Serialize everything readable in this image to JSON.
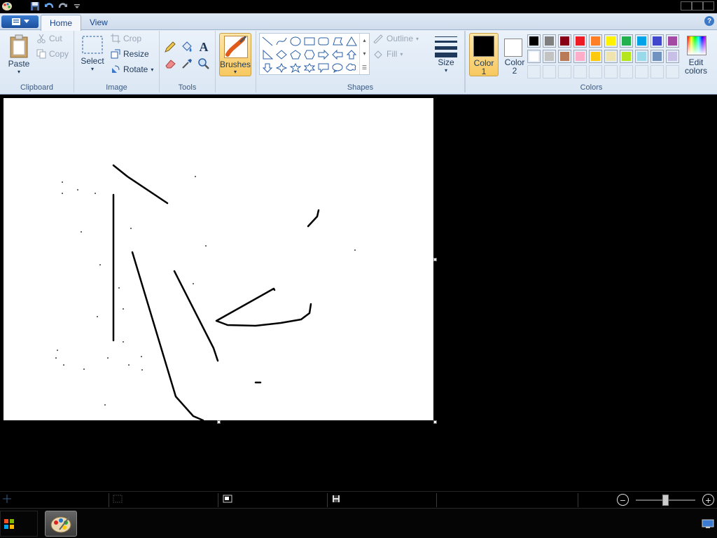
{
  "ribbon": {
    "tabs": [
      {
        "label": "Home",
        "active": true
      },
      {
        "label": "View",
        "active": false
      }
    ],
    "help_label": "?",
    "groups": {
      "clipboard": {
        "label": "Clipboard",
        "paste": "Paste",
        "cut": "Cut",
        "copy": "Copy"
      },
      "image": {
        "label": "Image",
        "select": "Select",
        "crop": "Crop",
        "resize": "Resize",
        "rotate": "Rotate"
      },
      "tools": {
        "label": "Tools"
      },
      "brushes": {
        "label": "Brushes"
      },
      "shapes": {
        "label": "Shapes",
        "outline": "Outline",
        "fill": "Fill"
      },
      "size": {
        "label": "Size"
      },
      "colors": {
        "label": "Colors",
        "color1": "Color\n1",
        "color2": "Color\n2",
        "edit_colors": "Edit\ncolors",
        "color1_value": "#000000",
        "color2_value": "#ffffff",
        "palette_row1": [
          "#000000",
          "#7f7f7f",
          "#880015",
          "#ed1c24",
          "#ff7f27",
          "#fff200",
          "#22b14c",
          "#00a2e8",
          "#3f48cc",
          "#a349a4"
        ],
        "palette_row2": [
          "#ffffff",
          "#c3c3c3",
          "#b97a57",
          "#ffaec9",
          "#ffc90e",
          "#efe4b0",
          "#b5e61d",
          "#99d9ea",
          "#7092be",
          "#c8bfe7"
        ],
        "palette_row3": [
          "",
          "",
          "",
          "",
          "",
          "",
          "",
          "",
          "",
          ""
        ]
      }
    }
  },
  "accent": {
    "brushes_active": "#fcd37a",
    "ribbon_text": "#1e395b"
  },
  "status": {
    "zoom_minus": "−",
    "zoom_plus": "+"
  }
}
